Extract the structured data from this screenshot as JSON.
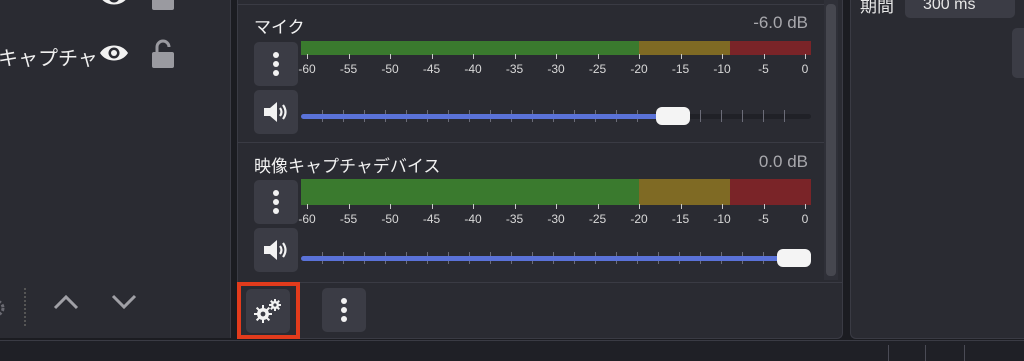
{
  "left_panel": {
    "source_label": "キャプチャ"
  },
  "mixer": {
    "channels": [
      {
        "name": "マイク",
        "db": "-6.0 dB",
        "volume_fraction": 0.73
      },
      {
        "name": "映像キャプチャデバイス",
        "db": "0.0 dB",
        "volume_fraction": 0.98
      }
    ],
    "scale_labels": [
      "-60",
      "-55",
      "-50",
      "-45",
      "-40",
      "-35",
      "-30",
      "-25",
      "-20",
      "-15",
      "-10",
      "-5",
      "0"
    ],
    "meter_colors": {
      "green": "#3a7a2e",
      "yellow": "#7f6a24",
      "red": "#7a2428",
      "fill": "#5a72d8",
      "highlight": "#e23b1c"
    }
  },
  "right_panel": {
    "label": "期間",
    "field_value": "300 ms"
  }
}
